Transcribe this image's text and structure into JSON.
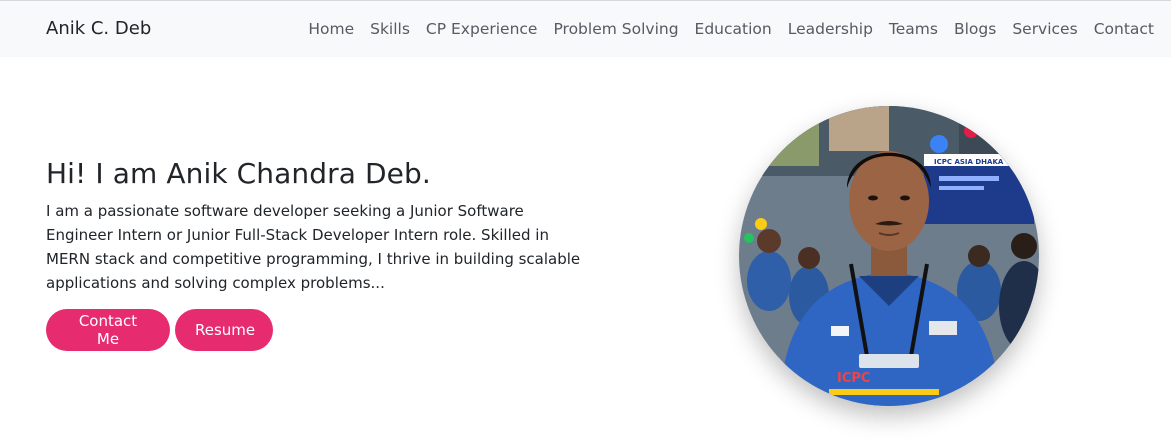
{
  "navbar": {
    "brand": "Anik C. Deb",
    "links": [
      "Home",
      "Skills",
      "CP Experience",
      "Problem Solving",
      "Education",
      "Leadership",
      "Teams",
      "Blogs",
      "Services",
      "Contact"
    ]
  },
  "hero": {
    "title": "Hi! I am Anik Chandra Deb.",
    "description": "I am a passionate software developer seeking a Junior Software Engineer Intern or Junior Full-Stack Developer Intern role. Skilled in MERN stack and competitive programming, I thrive in building scalable applications and solving complex problems...",
    "buttons": {
      "contact": "Contact Me",
      "resume": "Resume"
    }
  },
  "profile_photo": {
    "banner_text": "ICPC ASIA DHAKA"
  },
  "colors": {
    "accent": "#e62b6f",
    "navbar_bg": "#f8f9fa",
    "nav_link": "#555b61"
  }
}
